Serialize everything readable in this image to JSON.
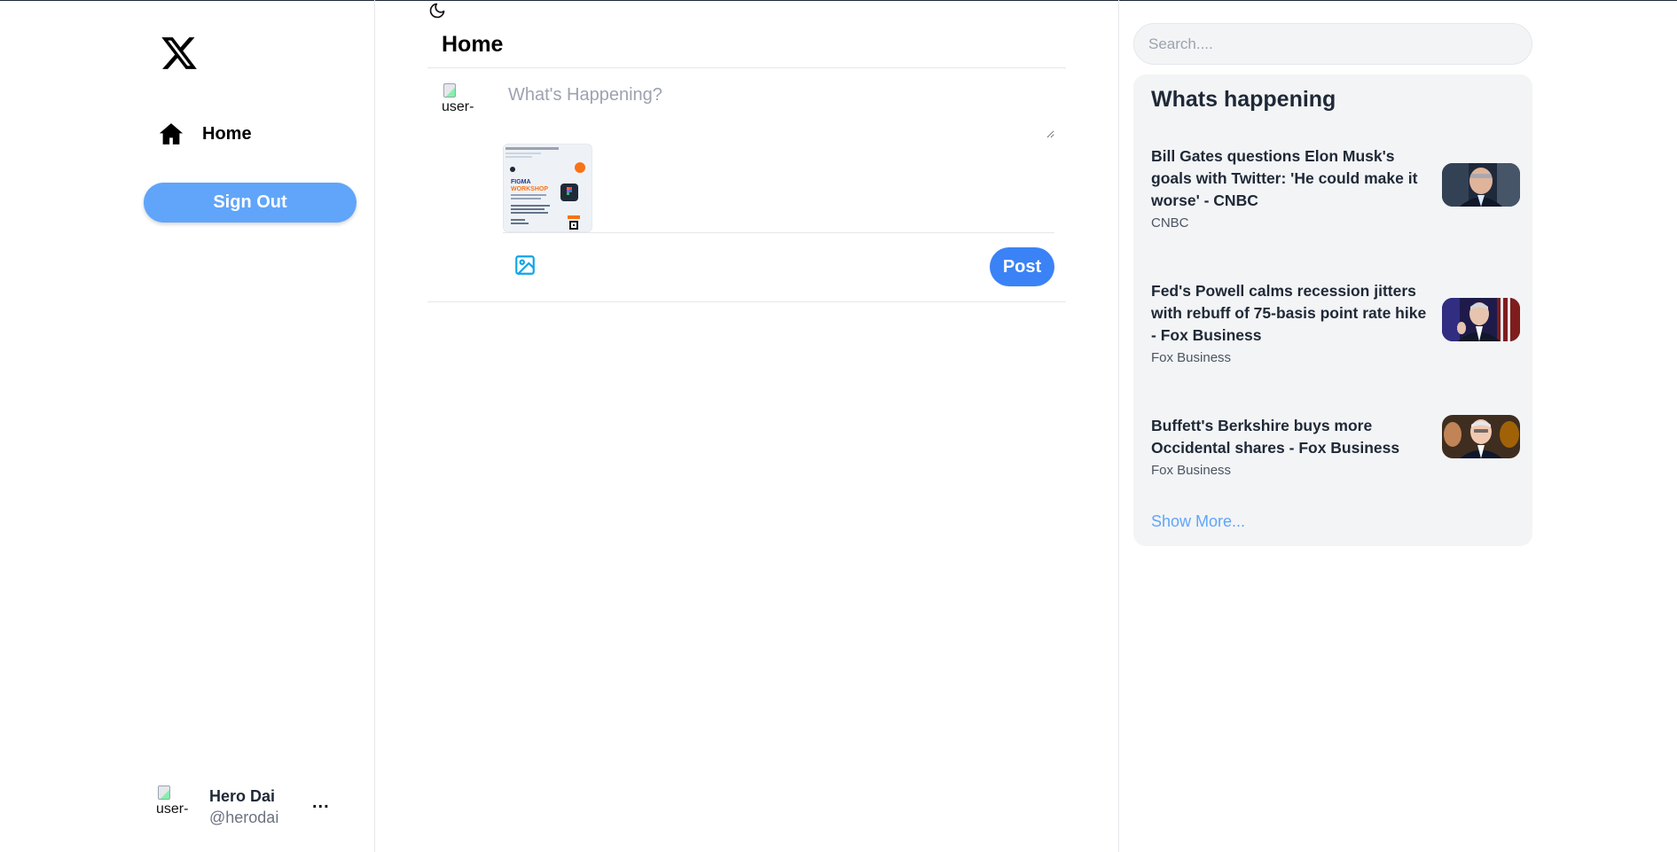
{
  "sidebar": {
    "nav": [
      {
        "label": "Home",
        "icon": "home-icon"
      }
    ],
    "signout_label": "Sign Out",
    "profile": {
      "avatar_alt": "user-",
      "name": "Hero Dai",
      "handle": "@herodai",
      "more": "..."
    }
  },
  "main": {
    "title": "Home",
    "composer": {
      "avatar_alt": "user-",
      "placeholder": "What's Happening?",
      "post_label": "Post"
    }
  },
  "right": {
    "search_placeholder": "Search....",
    "trends_title": "Whats happening",
    "trends": [
      {
        "headline": "Bill Gates questions Elon Musk's goals with Twitter: 'He could make it worse' - CNBC",
        "source": "CNBC"
      },
      {
        "headline": "Fed's Powell calms recession jitters with rebuff of 75-basis point rate hike - Fox Business",
        "source": "Fox Business"
      },
      {
        "headline": "Buffett's Berkshire buys more Occidental shares - Fox Business",
        "source": "Fox Business"
      }
    ],
    "show_more": "Show More..."
  },
  "colors": {
    "accent": "#3b82f6",
    "signout": "#60a5fa",
    "link": "#60a5fa",
    "panel": "#f3f4f6"
  }
}
